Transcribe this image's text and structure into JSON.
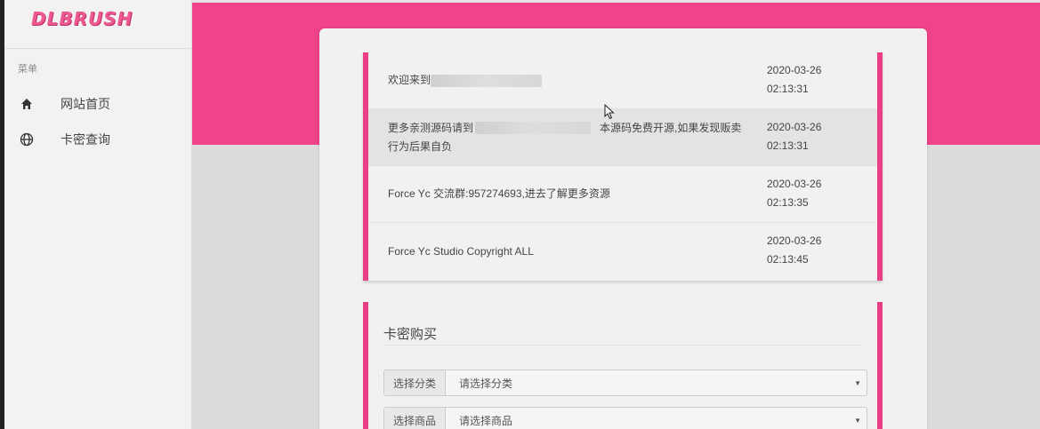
{
  "brand": {
    "logo_text": "DLBRUSH"
  },
  "sidebar": {
    "menu_title": "菜单",
    "items": [
      {
        "label": "网站首页",
        "icon": "home-icon"
      },
      {
        "label": "卡密查询",
        "icon": "globe-icon"
      }
    ]
  },
  "notices": [
    {
      "text": "欢迎来到",
      "time_date": "2020-03-26",
      "time_clock": "02:13:31"
    },
    {
      "text_before": "更多亲测源码请到",
      "text_after": "本源码免费开源,如果发现贩卖",
      "text_line2": "行为后果自负",
      "time_date": "2020-03-26",
      "time_clock": "02:13:31"
    },
    {
      "text": "Force Yc 交流群:957274693,进去了解更多资源",
      "time_date": "2020-03-26",
      "time_clock": "02:13:35"
    },
    {
      "text": "Force Yc Studio Copyright ALL",
      "time_date": "2020-03-26",
      "time_clock": "02:13:45"
    }
  ],
  "purchase": {
    "title": "卡密购买",
    "category": {
      "label": "选择分类",
      "value": "请选择分类"
    },
    "product": {
      "label": "选择商品",
      "value": "请选择商品"
    }
  },
  "colors": {
    "accent": "#f0438a",
    "panel_border": "#ea3e86"
  }
}
